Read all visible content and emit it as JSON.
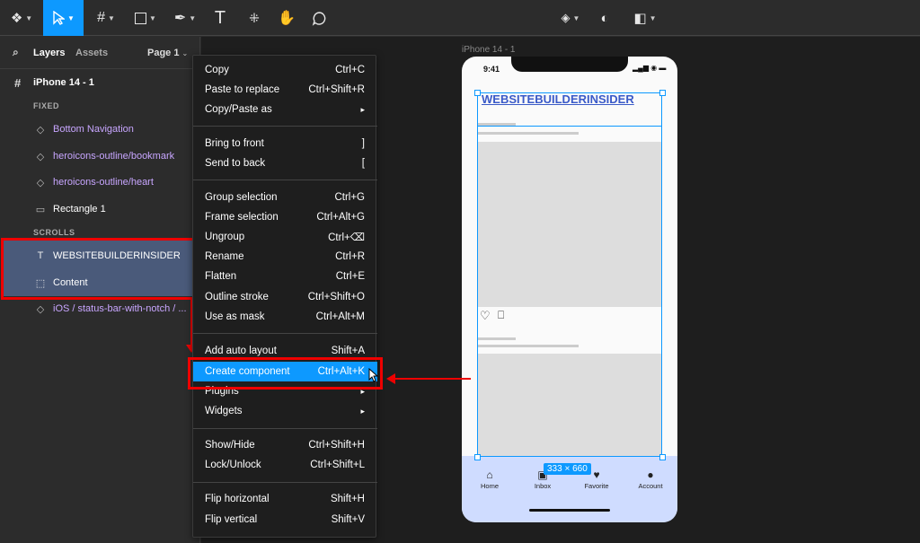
{
  "toolbar": {
    "main_menu_icon": "figma-logo-icon",
    "move_tool_icon": "move-cursor-icon",
    "frame_tool_icon": "hash-icon",
    "shape_tool_icon": "rectangle-icon",
    "pen_tool_icon": "pen-icon",
    "text_tool_label": "T",
    "resources_icon": "resources-icon",
    "hand_tool_icon": "hand-icon",
    "comment_icon": "comment-icon",
    "component_icon": "component-icon",
    "mask_icon": "contrast-icon",
    "boolean_icon": "boolean-icon"
  },
  "sidebar": {
    "tab_layers": "Layers",
    "tab_assets": "Assets",
    "page_selector": "Page 1",
    "frame_name": "iPhone 14 - 1",
    "section_fixed": "FIXED",
    "section_scrolls": "SCROLLS",
    "layers": [
      {
        "label": "Bottom Navigation",
        "icon": "component-instance-icon"
      },
      {
        "label": "heroicons-outline/bookmark",
        "icon": "component-instance-icon"
      },
      {
        "label": "heroicons-outline/heart",
        "icon": "component-instance-icon"
      },
      {
        "label": "Rectangle 1",
        "icon": "rectangle-icon"
      },
      {
        "label": "WEBSITEBUILDERINSIDER",
        "icon": "text-icon"
      },
      {
        "label": "Content",
        "icon": "frame-dashed-icon"
      },
      {
        "label": "iOS / status-bar-with-notch / ...",
        "icon": "component-instance-icon"
      }
    ]
  },
  "context_menu": {
    "groups": [
      [
        {
          "label": "Copy",
          "shortcut": "Ctrl+C"
        },
        {
          "label": "Paste to replace",
          "shortcut": "Ctrl+Shift+R"
        },
        {
          "label": "Copy/Paste as",
          "shortcut": "▸"
        }
      ],
      [
        {
          "label": "Bring to front",
          "shortcut": "]"
        },
        {
          "label": "Send to back",
          "shortcut": "["
        }
      ],
      [
        {
          "label": "Group selection",
          "shortcut": "Ctrl+G"
        },
        {
          "label": "Frame selection",
          "shortcut": "Ctrl+Alt+G"
        },
        {
          "label": "Ungroup",
          "shortcut": "Ctrl+⌫"
        },
        {
          "label": "Rename",
          "shortcut": "Ctrl+R"
        },
        {
          "label": "Flatten",
          "shortcut": "Ctrl+E"
        },
        {
          "label": "Outline stroke",
          "shortcut": "Ctrl+Shift+O"
        },
        {
          "label": "Use as mask",
          "shortcut": "Ctrl+Alt+M"
        }
      ],
      [
        {
          "label": "Add auto layout",
          "shortcut": "Shift+A"
        },
        {
          "label": "Create component",
          "shortcut": "Ctrl+Alt+K"
        },
        {
          "label": "Plugins",
          "shortcut": "▸"
        },
        {
          "label": "Widgets",
          "shortcut": "▸"
        }
      ],
      [
        {
          "label": "Show/Hide",
          "shortcut": "Ctrl+Shift+H"
        },
        {
          "label": "Lock/Unlock",
          "shortcut": "Ctrl+Shift+L"
        }
      ],
      [
        {
          "label": "Flip horizontal",
          "shortcut": "Shift+H"
        },
        {
          "label": "Flip vertical",
          "shortcut": "Shift+V"
        }
      ]
    ]
  },
  "canvas": {
    "frame_label": "iPhone 14 - 1",
    "status_time": "9:41",
    "title_text": "WEBSITEBUILDERINSIDER",
    "size_badge": "333 × 660",
    "nav": [
      "Home",
      "Inbox",
      "Favorite",
      "Account"
    ]
  },
  "colors": {
    "accent": "#0d99ff",
    "highlight_red": "#e00000",
    "bottom_nav_bg": "#cfdcff",
    "component_purple": "#c8a6ff"
  }
}
